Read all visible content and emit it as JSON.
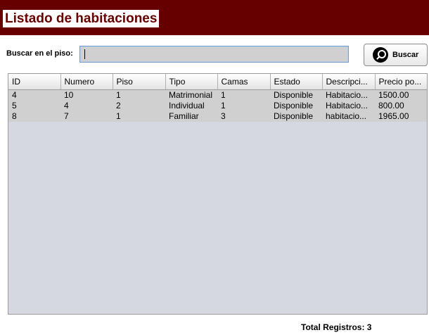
{
  "header": {
    "title": "Listado de habitaciones"
  },
  "search": {
    "label": "Buscar en el piso:",
    "value": "",
    "button_label": "Buscar"
  },
  "table": {
    "columns": [
      "ID",
      "Numero",
      "Piso",
      "Tipo",
      "Camas",
      "Estado",
      "Descripci...",
      "Precio po..."
    ],
    "rows": [
      [
        "4",
        "10",
        "1",
        "Matrimonial",
        "1",
        "Disponible",
        "Habitacio...",
        "1500.00"
      ],
      [
        "5",
        "4",
        "2",
        "Individual",
        "1",
        "Disponible",
        "Habitacio...",
        "800.00"
      ],
      [
        "8",
        "7",
        "1",
        "Familiar",
        "3",
        "Disponible",
        "habitacio...",
        "1965.00"
      ]
    ]
  },
  "footer": {
    "total_text": "Total Registros: 3"
  },
  "colors": {
    "header_bg": "#660000",
    "header_text": "#660000",
    "table_bg": "#d5d8e0",
    "row_bg": "#d0d0d0"
  }
}
